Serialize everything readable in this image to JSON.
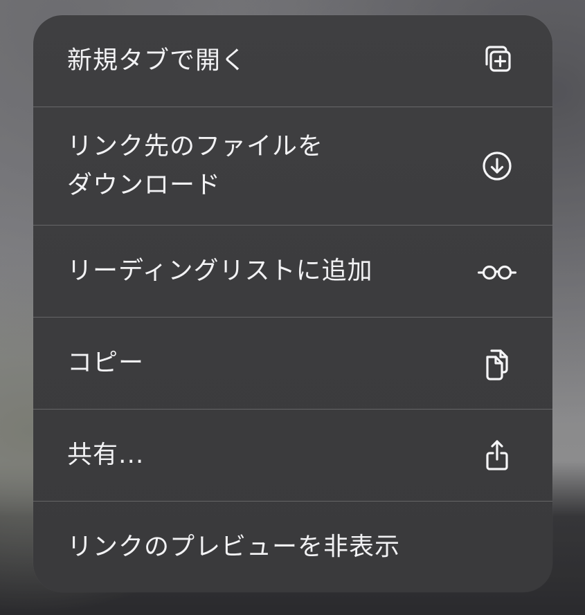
{
  "context_menu": {
    "items": [
      {
        "label": "新規タブで開く",
        "icon": "new-tab-plus-icon"
      },
      {
        "label_lines": [
          "リンク先のファイルを",
          "ダウンロード"
        ],
        "icon": "download-circle-icon"
      },
      {
        "label": "リーディングリストに追加",
        "icon": "glasses-icon"
      },
      {
        "label": "コピー",
        "icon": "copy-documents-icon"
      },
      {
        "label": "共有...",
        "icon": "share-icon"
      },
      {
        "label": "リンクのプレビューを非表示"
      }
    ],
    "colors": {
      "menu_background": "#3d3d3f",
      "text": "#f2f2f4",
      "separator": "rgba(255,255,255,0.22)"
    }
  }
}
